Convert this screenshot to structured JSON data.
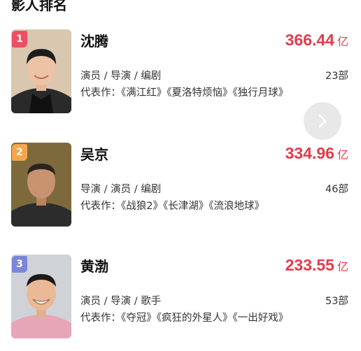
{
  "section_title": "影人排名",
  "colors": {
    "accent_red": "#e53b4b",
    "rank1": "#ef4f62",
    "rank2": "#f5a64a",
    "rank3": "#7b86d8"
  },
  "people": [
    {
      "rank": "1",
      "name": "沈腾",
      "box_office": "366.44",
      "unit": "亿",
      "roles": "演员 / 导演 / 编剧",
      "film_count": "23部",
      "works": "代表作：《满江红》《夏洛特烦恼》《独行月球》"
    },
    {
      "rank": "2",
      "name": "吴京",
      "box_office": "334.96",
      "unit": "亿",
      "roles": "导演 / 演员 / 编剧",
      "film_count": "46部",
      "works": "代表作：《战狼2》《长津湖》《流浪地球》"
    },
    {
      "rank": "3",
      "name": "黄渤",
      "box_office": "233.55",
      "unit": "亿",
      "roles": "演员 / 导演 / 歌手",
      "film_count": "53部",
      "works": "代表作：《夺冠》《疯狂的外星人》《一出好戏》"
    }
  ],
  "next_button": {
    "icon": "chevron-right-icon"
  }
}
